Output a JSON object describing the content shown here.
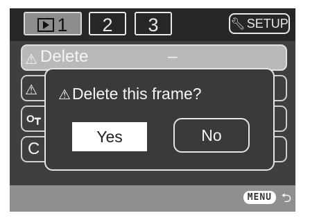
{
  "tabs": [
    {
      "label": "1",
      "icon": "playback-icon"
    },
    {
      "label": "2"
    },
    {
      "label": "3"
    },
    {
      "label": "SETUP",
      "icon": "wrench-icon"
    }
  ],
  "menu": {
    "rows": [
      {
        "icon": "warning-icon",
        "label": "Delete",
        "value": "–"
      },
      {
        "icon": "warning-icon",
        "label": "",
        "value": ""
      },
      {
        "icon": "key-icon",
        "label": "",
        "value": ""
      },
      {
        "icon": "",
        "label": "C",
        "value": ""
      }
    ]
  },
  "dialog": {
    "title": "Delete this frame?",
    "yes_label": "Yes",
    "no_label": "No"
  },
  "footer": {
    "menu_label": "MENU",
    "return_icon": "return-arrow-icon"
  },
  "colors": {
    "screen_bg": "#3f3f3f",
    "selected_row": "#b9b9b9",
    "bottom_bar": "#8f8f8f"
  }
}
